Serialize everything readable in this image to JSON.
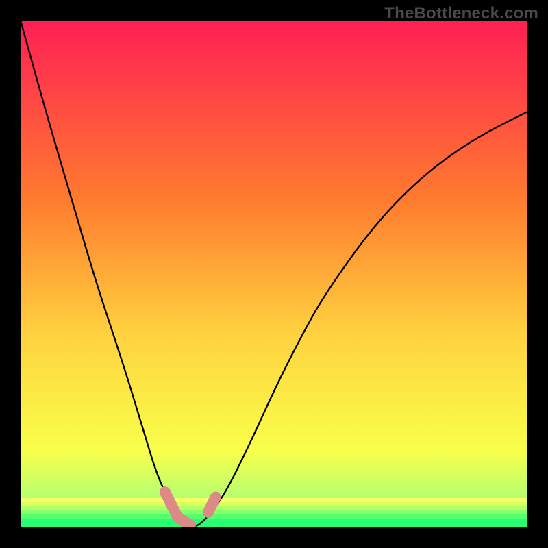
{
  "watermark": "TheBottleneck.com",
  "colors": {
    "gradient_top": "#ff1f55",
    "gradient_upper_mid": "#ff7a2f",
    "gradient_mid": "#ffd23f",
    "gradient_lower": "#f8ff4a",
    "gradient_light_green": "#b6ff70",
    "gradient_green": "#2fff75",
    "curve": "#000000",
    "marker": "#dd8a87",
    "frame": "#000000"
  },
  "chart_data": {
    "type": "line",
    "title": "",
    "xlabel": "",
    "ylabel": "",
    "xlim": [
      0,
      100
    ],
    "ylim": [
      0,
      100
    ],
    "legend": false,
    "annotations": [
      "TheBottleneck.com"
    ],
    "series": [
      {
        "name": "bottleneck-curve",
        "x": [
          0,
          5,
          10,
          15,
          20,
          24,
          27,
          30,
          32,
          34,
          36,
          40,
          45,
          50,
          55,
          60,
          70,
          80,
          90,
          100
        ],
        "y": [
          100,
          82,
          65,
          48,
          33,
          20,
          10,
          4,
          1,
          0,
          1,
          6,
          16,
          27,
          37,
          46,
          60,
          70,
          77,
          82
        ]
      }
    ],
    "markers": [
      {
        "name": "left-marker-start",
        "x": 28.5,
        "y": 7
      },
      {
        "name": "left-marker-end",
        "x": 31.0,
        "y": 2
      },
      {
        "name": "bottom-marker",
        "x": 33.5,
        "y": 0.5
      },
      {
        "name": "right-marker-start",
        "x": 37.0,
        "y": 3
      },
      {
        "name": "right-marker-end",
        "x": 38.5,
        "y": 6
      }
    ],
    "green_band_fraction": 0.06
  }
}
